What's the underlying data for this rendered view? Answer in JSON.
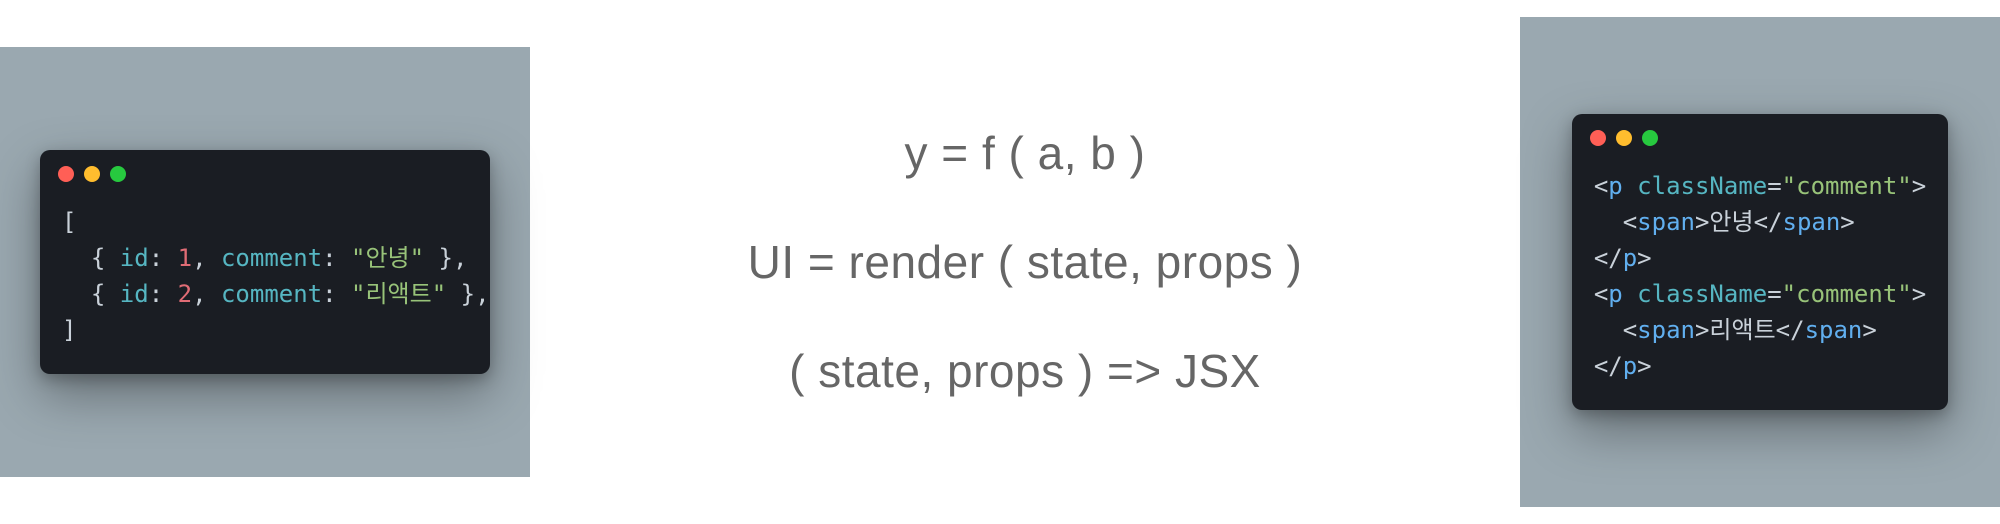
{
  "left_code": {
    "line1": "[",
    "obj1": {
      "open": "  { ",
      "key_id": "id",
      "colon1": ": ",
      "val_id": "1",
      "comma1": ", ",
      "key_comment": "comment",
      "colon2": ": ",
      "val_comment": "\"안녕\"",
      "close": " },"
    },
    "obj2": {
      "open": "  { ",
      "key_id": "id",
      "colon1": ": ",
      "val_id": "2",
      "comma1": ", ",
      "key_comment": "comment",
      "colon2": ": ",
      "val_comment": "\"리액트\"",
      "close": " },"
    },
    "line4": "]"
  },
  "center": {
    "formula1": "y = f ( a, b )",
    "formula2": "UI = render ( state, props )",
    "formula3": "( state, props ) => JSX"
  },
  "right_code": {
    "p1_open": {
      "lt": "<",
      "tag": "p",
      "sp": " ",
      "attr": "className",
      "eq": "=",
      "val": "\"comment\"",
      "gt": ">"
    },
    "span1": {
      "indent": "  ",
      "lt": "<",
      "tag": "span",
      "gt": ">",
      "text": "안녕",
      "lt2": "</",
      "tag2": "span",
      "gt2": ">"
    },
    "p1_close": {
      "lt": "</",
      "tag": "p",
      "gt": ">"
    },
    "p2_open": {
      "lt": "<",
      "tag": "p",
      "sp": " ",
      "attr": "className",
      "eq": "=",
      "val": "\"comment\"",
      "gt": ">"
    },
    "span2": {
      "indent": "  ",
      "lt": "<",
      "tag": "span",
      "gt": ">",
      "text": "리액트",
      "lt2": "</",
      "tag2": "span",
      "gt2": ">"
    },
    "p2_close": {
      "lt": "</",
      "tag": "p",
      "gt": ">"
    }
  },
  "colors": {
    "panel_bg": "#9aa8b0",
    "terminal_bg": "#1a1d23",
    "traffic_red": "#ff5f56",
    "traffic_yellow": "#ffbd2e",
    "traffic_green": "#27c93f"
  }
}
